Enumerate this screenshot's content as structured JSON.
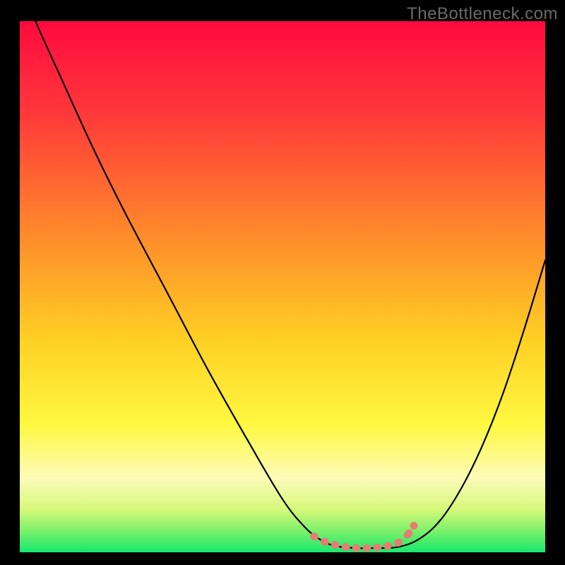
{
  "watermark": "TheBottleneck.com",
  "colors": {
    "topRed": "#ff0a3f",
    "orange": "#ff7a2a",
    "yellow": "#ffe524",
    "paleYellow": "#fdfcb0",
    "green": "#17e86e",
    "curve": "#000000",
    "marker": "#e77d72",
    "frame": "#000000"
  },
  "chart_data": {
    "type": "line",
    "title": "",
    "xlabel": "",
    "ylabel": "",
    "xlim": [
      0,
      100
    ],
    "ylim": [
      0,
      100
    ],
    "series": [
      {
        "name": "bottleneck-curve",
        "x": [
          0,
          3,
          8,
          14,
          20,
          28,
          36,
          44,
          50,
          54,
          57,
          60,
          64,
          68,
          72,
          76,
          80,
          84,
          88,
          92,
          96,
          100
        ],
        "y": [
          108,
          100,
          89,
          76,
          64,
          49,
          34,
          20,
          10,
          5,
          2.5,
          1.2,
          0.8,
          0.8,
          1.0,
          2.5,
          6,
          12,
          20,
          30,
          42,
          55
        ]
      }
    ],
    "marker_region": {
      "name": "optimal-range",
      "points": [
        {
          "x": 56,
          "y": 3.0
        },
        {
          "x": 58,
          "y": 2.0
        },
        {
          "x": 60,
          "y": 1.4
        },
        {
          "x": 62,
          "y": 1.0
        },
        {
          "x": 64,
          "y": 0.8
        },
        {
          "x": 66,
          "y": 0.8
        },
        {
          "x": 68,
          "y": 0.9
        },
        {
          "x": 70,
          "y": 1.2
        },
        {
          "x": 72,
          "y": 1.8
        },
        {
          "x": 74,
          "y": 3.5
        },
        {
          "x": 75,
          "y": 5.0
        }
      ]
    },
    "gradient_stops": [
      {
        "offset": 0.0,
        "color": "#ff0a3f"
      },
      {
        "offset": 0.18,
        "color": "#ff3a3a"
      },
      {
        "offset": 0.4,
        "color": "#ff8a2a"
      },
      {
        "offset": 0.6,
        "color": "#ffd024"
      },
      {
        "offset": 0.76,
        "color": "#fff840"
      },
      {
        "offset": 0.86,
        "color": "#fcfbb8"
      },
      {
        "offset": 0.92,
        "color": "#d6f87a"
      },
      {
        "offset": 0.96,
        "color": "#7af06a"
      },
      {
        "offset": 1.0,
        "color": "#17e86e"
      }
    ]
  }
}
